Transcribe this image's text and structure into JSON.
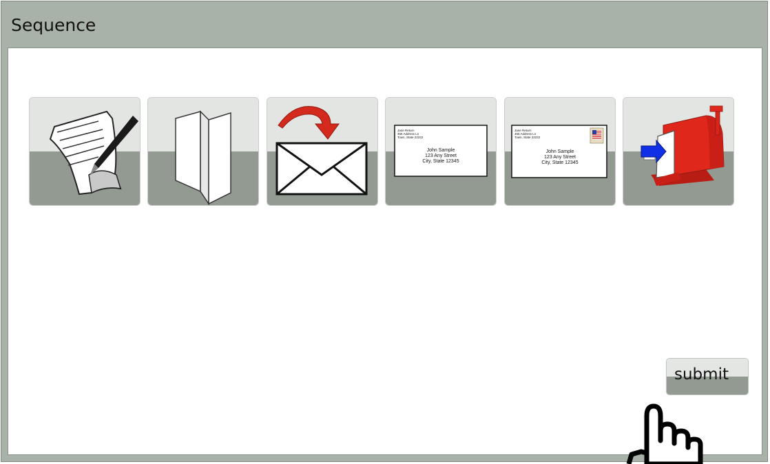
{
  "window": {
    "title": "Sequence"
  },
  "steps": [
    {
      "icon": "write-letter-icon"
    },
    {
      "icon": "folded-letter-icon"
    },
    {
      "icon": "insert-into-envelope-icon"
    },
    {
      "icon": "addressed-envelope-icon",
      "return_address": [
        "Jane Return",
        "456 Address Ln",
        "Town, State 22222"
      ],
      "recipient": [
        "John Sample",
        "123 Any Street",
        "City, State 12345"
      ]
    },
    {
      "icon": "stamped-envelope-icon",
      "return_address": [
        "Jane Return",
        "456 Address Ln",
        "Town, State 22222"
      ],
      "recipient": [
        "John Sample",
        "123 Any Street",
        "City, State 12345"
      ]
    },
    {
      "icon": "mailbox-icon"
    }
  ],
  "submit": {
    "label": "submit"
  },
  "colors": {
    "frame": "#a9b2a8",
    "tile_top": "#e3e5e3",
    "tile_bottom": "#929a92",
    "arrow_red": "#d42a1e",
    "mailbox_red": "#e0271c",
    "arrow_blue": "#1030e8"
  }
}
